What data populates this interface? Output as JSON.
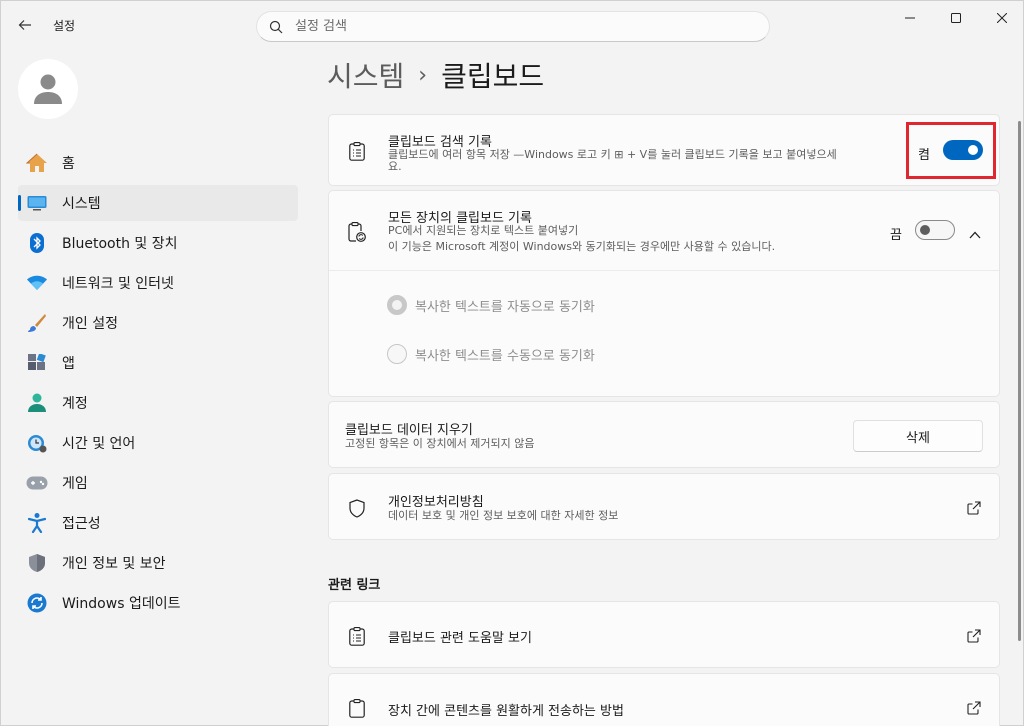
{
  "window": {
    "app_title": "설정",
    "search_placeholder": "설정 검색",
    "controls": [
      "minimize-icon",
      "maximize-icon",
      "close-icon"
    ]
  },
  "sidebar": {
    "items": [
      {
        "label": "홈",
        "icon": "home-icon"
      },
      {
        "label": "시스템",
        "icon": "system-icon",
        "active": true
      },
      {
        "label": "Bluetooth 및 장치",
        "icon": "bluetooth-icon"
      },
      {
        "label": "네트워크 및 인터넷",
        "icon": "wifi-icon"
      },
      {
        "label": "개인 설정",
        "icon": "brush-icon"
      },
      {
        "label": "앱",
        "icon": "apps-icon"
      },
      {
        "label": "계정",
        "icon": "account-icon"
      },
      {
        "label": "시간 및 언어",
        "icon": "clock-globe-icon"
      },
      {
        "label": "게임",
        "icon": "gamepad-icon"
      },
      {
        "label": "접근성",
        "icon": "accessibility-icon"
      },
      {
        "label": "개인 정보 및 보안",
        "icon": "shield-icon"
      },
      {
        "label": "Windows 업데이트",
        "icon": "update-icon"
      }
    ]
  },
  "breadcrumb": {
    "parent": "시스템",
    "separator": "›",
    "current": "클립보드"
  },
  "clipboard_history": {
    "title": "클립보드 검색 기록",
    "desc_line1": "클립보드에 여러 항목 저장 —Windows 로고 키 ⊞ + V를 눌러 클립보드 기록을 보고 붙여넣으세",
    "desc_line2": "요.",
    "toggle_label": "켬",
    "toggle_on": true
  },
  "sync_across_devices": {
    "title": "모든 장치의 클립보드 기록",
    "desc_line1": "PC에서 지원되는 장치로 텍스트 붙여넣기",
    "desc_line2": "이 기능은 Microsoft 계정이 Windows와 동기화되는 경우에만 사용할 수 있습니다.",
    "toggle_label": "끔",
    "toggle_on": false,
    "options": [
      {
        "label": "복사한 텍스트를 자동으로 동기화",
        "selected": true
      },
      {
        "label": "복사한 텍스트를 수동으로 동기화",
        "selected": false
      }
    ]
  },
  "clear_data": {
    "title": "클립보드 데이터 지우기",
    "desc": "고정된 항목은 이 장치에서 제거되지 않음",
    "button": "삭제"
  },
  "privacy": {
    "title": "개인정보처리방침",
    "desc": "데이터 보호 및 개인 정보 보호에 대한 자세한 정보"
  },
  "related": {
    "heading": "관련 링크",
    "links": [
      {
        "label": "클립보드 관련 도움말 보기"
      },
      {
        "label": "장치 간에 콘텐츠를 원활하게 전송하는 방법"
      }
    ]
  },
  "colors": {
    "accent": "#0067c0",
    "highlight": "#e0262f"
  }
}
